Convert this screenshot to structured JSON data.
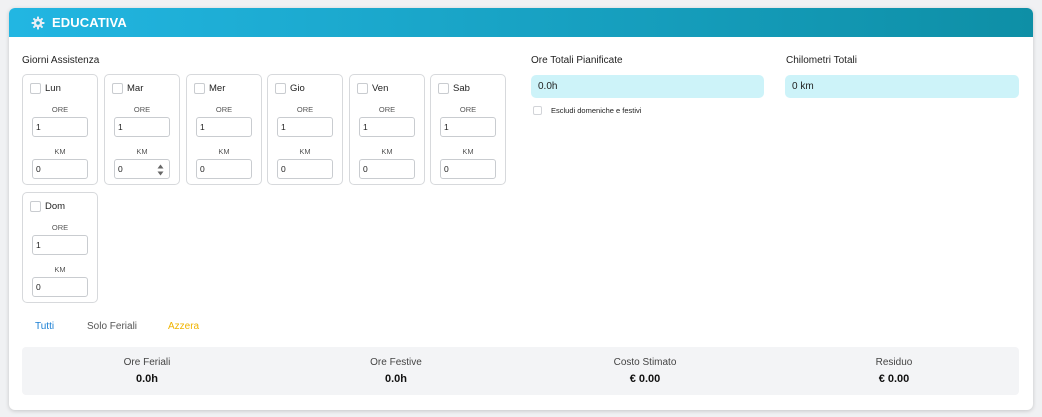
{
  "panel": {
    "title": "EDUCATIVA",
    "header_gradient": [
      "#22b6e2",
      "#0e8fa6"
    ]
  },
  "giorni": {
    "label": "Giorni Assistenza",
    "ore_label": "ORE",
    "km_label": "KM",
    "days": [
      {
        "name": "Lun",
        "ore": "1",
        "km": "0",
        "checked": false
      },
      {
        "name": "Mar",
        "ore": "1",
        "km": "0",
        "checked": false
      },
      {
        "name": "Mer",
        "ore": "1",
        "km": "0",
        "checked": false
      },
      {
        "name": "Gio",
        "ore": "1",
        "km": "0",
        "checked": false
      },
      {
        "name": "Ven",
        "ore": "1",
        "km": "0",
        "checked": false
      },
      {
        "name": "Sab",
        "ore": "1",
        "km": "0",
        "checked": false
      },
      {
        "name": "Dom",
        "ore": "1",
        "km": "0",
        "checked": false
      }
    ]
  },
  "totals": {
    "ore_label": "Ore Totali Pianificate",
    "ore_value": "0.0h",
    "km_label": "Chilometri Totali",
    "km_value": "0 km",
    "exclude_label": "Escludi domeniche e festivi",
    "input_bg": "#cdf3f9"
  },
  "quick": {
    "tutti": "Tutti",
    "solo_feriali": "Solo Feriali",
    "azzera": "Azzera",
    "tutti_color": "#1a7fd4",
    "azzera_color": "#f0b400"
  },
  "stats": [
    {
      "label": "Ore Feriali",
      "value": "0.0h"
    },
    {
      "label": "Ore Festive",
      "value": "0.0h"
    },
    {
      "label": "Costo Stimato",
      "value": "€ 0.00"
    },
    {
      "label": "Residuo",
      "value": "€ 0.00"
    }
  ]
}
